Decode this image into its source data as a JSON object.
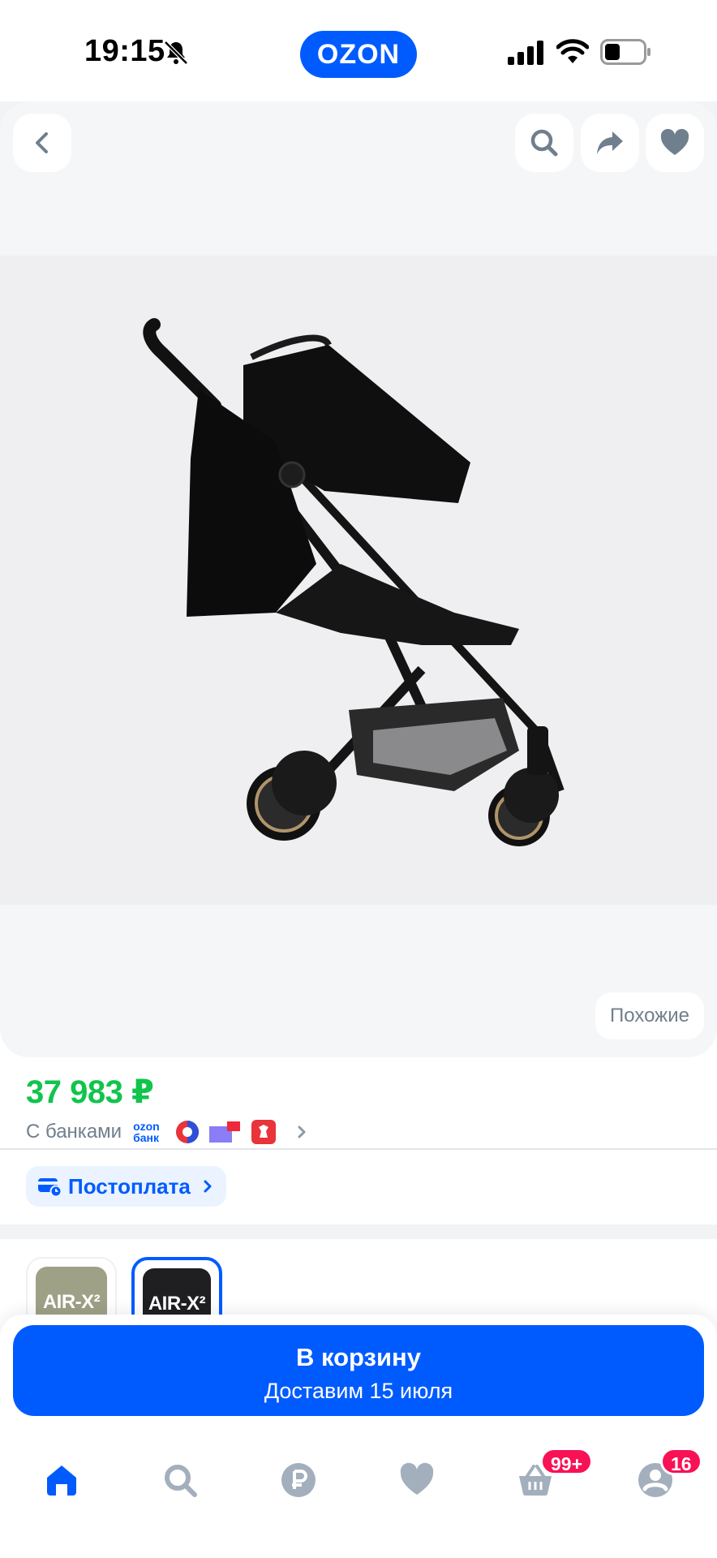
{
  "status_bar": {
    "time": "19:15",
    "brand": "OZON"
  },
  "gallery": {
    "similar_label": "Похожие"
  },
  "price": {
    "value": "37 983 ₽",
    "banks_label": "С банками",
    "ozon_bank_logo": "ozon банк"
  },
  "postpay": {
    "label": "Постоплата"
  },
  "variants": [
    {
      "label": "AIR-X²",
      "color": "#9ea185"
    },
    {
      "label": "AIR-X²",
      "color": "#1f1f21",
      "selected": true
    }
  ],
  "cart_button": {
    "title": "В корзину",
    "subtitle": "Доставим 15 июля"
  },
  "tab_bar": {
    "items": [
      {
        "icon": "home-icon",
        "active": true
      },
      {
        "icon": "search-icon"
      },
      {
        "icon": "ruble-icon"
      },
      {
        "icon": "heart-icon"
      },
      {
        "icon": "basket-icon",
        "badge": "99+"
      },
      {
        "icon": "profile-icon",
        "badge": "16"
      }
    ]
  },
  "colors": {
    "brand_blue": "#005bff",
    "price_green": "#10c44c",
    "badge_pink": "#f91155"
  }
}
